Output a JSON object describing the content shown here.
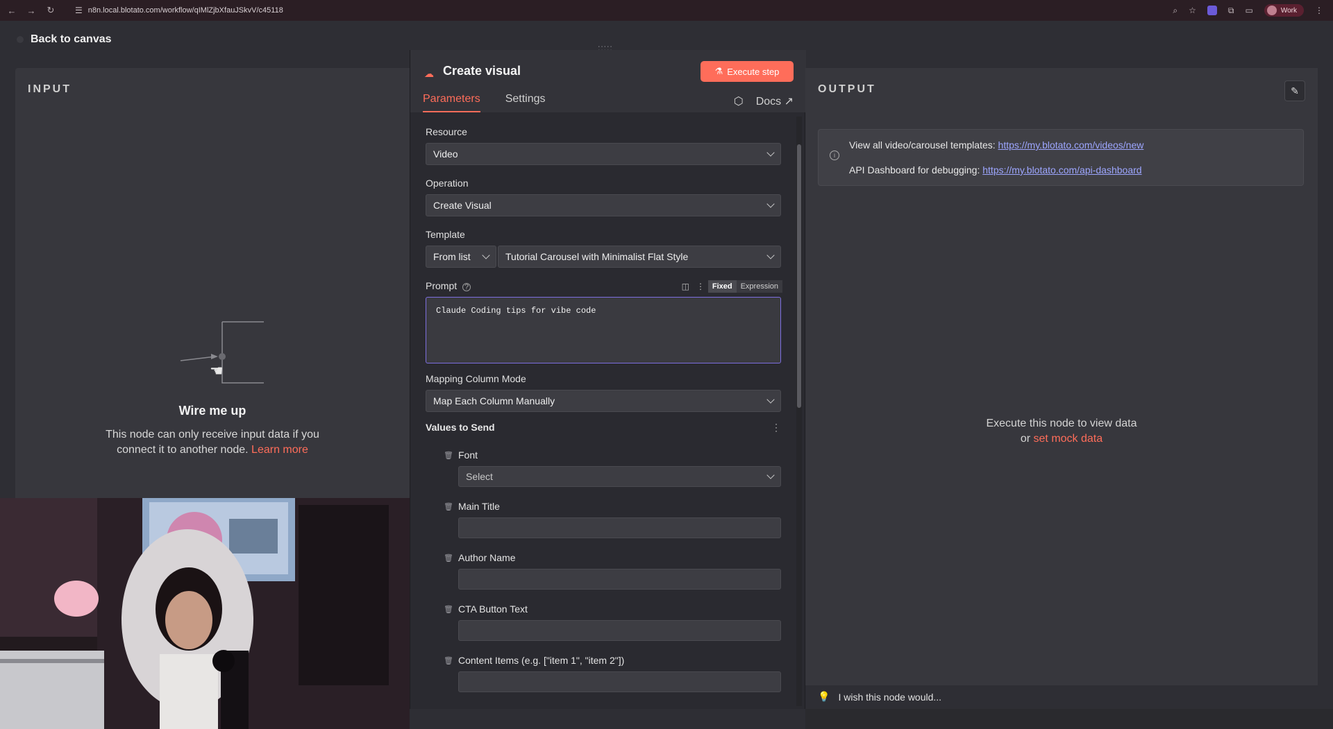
{
  "browser": {
    "url": "n8n.local.blotato.com/workflow/qIMlZjbXfauJSkvV/c45118",
    "profile": "Work"
  },
  "nav": {
    "back_label": "Back to canvas"
  },
  "input_panel": {
    "label": "INPUT",
    "title": "Wire me up",
    "desc_line1": "This node can only receive input data if you",
    "desc_line2": "connect it to another node.",
    "learn_more": "Learn more"
  },
  "node": {
    "title": "Create visual",
    "execute_label": "Execute step",
    "tabs": [
      {
        "label": "Parameters",
        "active": true
      },
      {
        "label": "Settings",
        "active": false
      }
    ],
    "docs_label": "Docs"
  },
  "form": {
    "resource": {
      "label": "Resource",
      "value": "Video"
    },
    "operation": {
      "label": "Operation",
      "value": "Create Visual"
    },
    "template": {
      "label": "Template",
      "mode": "From list",
      "value": "Tutorial Carousel with Minimalist Flat Style"
    },
    "prompt": {
      "label": "Prompt",
      "value": "Claude Coding tips for vibe code",
      "fixed": "Fixed",
      "expression": "Expression"
    },
    "mapping": {
      "label": "Mapping Column Mode",
      "value": "Map Each Column Manually"
    },
    "values_label": "Values to Send",
    "values": [
      {
        "label": "Font",
        "value": "Select",
        "is_select": true
      },
      {
        "label": "Main Title",
        "value": "",
        "is_select": false
      },
      {
        "label": "Author Name",
        "value": "",
        "is_select": false
      },
      {
        "label": "CTA Button Text",
        "value": "",
        "is_select": false
      },
      {
        "label": "Content Items (e.g. [\"item 1\", \"item 2\"])",
        "value": "",
        "is_select": false
      }
    ]
  },
  "output_panel": {
    "label": "OUTPUT",
    "info1_text": "View all video/carousel templates:",
    "info1_link": "https://my.blotato.com/videos/new",
    "info2_text": "API Dashboard for debugging:",
    "info2_link": "https://my.blotato.com/api-dashboard",
    "exec_msg": "Execute this node to view data",
    "or": "or",
    "mock_link": "set mock data"
  },
  "wish_label": "I wish this node would...",
  "colors": {
    "accent": "#ff6d5a",
    "link": "#9da6ff",
    "focus": "#7d6fe0"
  }
}
